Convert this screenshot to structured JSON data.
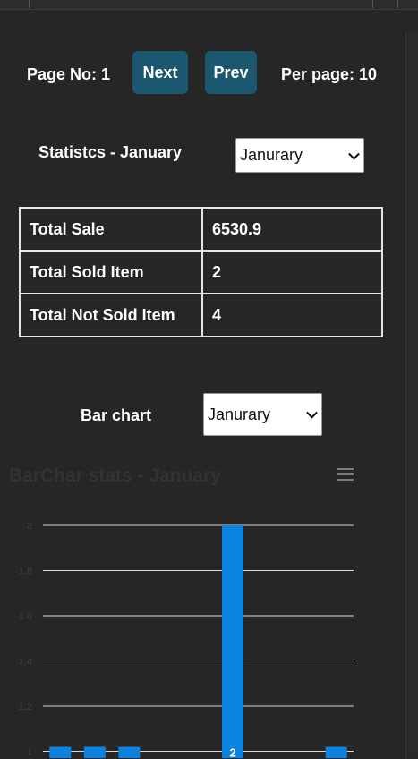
{
  "pager": {
    "page_label": "Page No: 1",
    "next_label": "Next",
    "prev_label": "Prev",
    "per_page_label": "Per page: 10"
  },
  "statistics": {
    "heading": "Statistcs - January",
    "month_select": "Janurary",
    "rows": [
      {
        "label": "Total Sale",
        "value": "6530.9"
      },
      {
        "label": "Total Sold Item",
        "value": "2"
      },
      {
        "label": "Total Not Sold Item",
        "value": "4"
      }
    ]
  },
  "bar_section": {
    "heading": "Bar chart",
    "month_select": "Janurary"
  },
  "chart_data": {
    "type": "bar",
    "title": "BarChar stats - January",
    "xlabel": "",
    "ylabel": "",
    "ylim": [
      1,
      2
    ],
    "y_ticks": [
      "1",
      "1.2",
      "1.4",
      "1.6",
      "1.8",
      "2"
    ],
    "grid": true,
    "bar_color": "#0a84e0",
    "bars": [
      {
        "value": 1,
        "label": ""
      },
      {
        "value": 1,
        "label": ""
      },
      {
        "value": 1,
        "label": ""
      },
      {
        "value": 0,
        "label": ""
      },
      {
        "value": 0,
        "label": ""
      },
      {
        "value": 2,
        "label": "2"
      },
      {
        "value": 0,
        "label": ""
      },
      {
        "value": 0,
        "label": ""
      },
      {
        "value": 1,
        "label": ""
      }
    ]
  }
}
